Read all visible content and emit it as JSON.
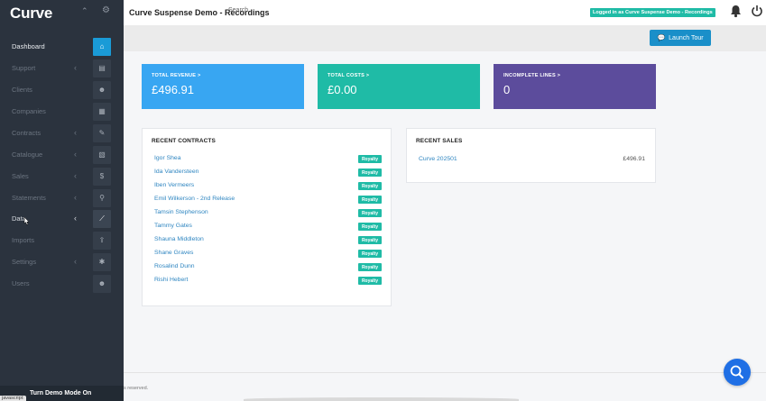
{
  "brand": {
    "logo_text": "Curve"
  },
  "sidebar": {
    "items": [
      {
        "label": "Dashboard",
        "icon": "home-icon",
        "glyph": "⌂"
      },
      {
        "label": "Support",
        "icon": "table-icon",
        "glyph": "▤",
        "chevron": "‹"
      },
      {
        "label": "Clients",
        "icon": "users-icon",
        "glyph": "☻"
      },
      {
        "label": "Companies",
        "icon": "building-icon",
        "glyph": "▦"
      },
      {
        "label": "Contracts",
        "icon": "pencil-icon",
        "glyph": "✎",
        "chevron": "‹"
      },
      {
        "label": "Catalogue",
        "icon": "book-icon",
        "glyph": "▧",
        "chevron": "‹"
      },
      {
        "label": "Sales",
        "icon": "dollar-icon",
        "glyph": "$",
        "chevron": "‹"
      },
      {
        "label": "Statements",
        "icon": "paperclip-icon",
        "glyph": "⚲",
        "chevron": "‹"
      },
      {
        "label": "Data",
        "icon": "chart-icon",
        "glyph": "⟋",
        "chevron": "‹"
      },
      {
        "label": "Imports",
        "icon": "upload-icon",
        "glyph": "⇪"
      },
      {
        "label": "Settings",
        "icon": "gear-icon",
        "glyph": "✱",
        "chevron": "‹"
      },
      {
        "label": "Users",
        "icon": "users-icon",
        "glyph": "☻"
      }
    ],
    "demo_mode_label": "Turn Demo Mode On",
    "status_text": "javascript:"
  },
  "header": {
    "title": "Curve Suspense Demo - Recordings",
    "search_ghost": "Search",
    "login_badge": "Logged in as Curve Suspense Demo - Recordings"
  },
  "toolbar": {
    "launch_tour_label": "Launch Tour"
  },
  "stats": [
    {
      "label": "TOTAL REVENUE >",
      "value": "£496.91",
      "color": "#38a6f2"
    },
    {
      "label": "TOTAL COSTS >",
      "value": "£0.00",
      "color": "#1fbba6"
    },
    {
      "label": "INCOMPLETE LINES >",
      "value": "0",
      "color": "#5c4c9c"
    }
  ],
  "recent_contracts": {
    "title": "RECENT CONTRACTS",
    "rows": [
      {
        "name": "Igor Shea",
        "badge": "Royalty"
      },
      {
        "name": "Ida Vandersteen",
        "badge": "Royalty"
      },
      {
        "name": "Iben Vermeers",
        "badge": "Royalty"
      },
      {
        "name": "Emil Wilkerson - 2nd Release",
        "badge": "Royalty"
      },
      {
        "name": "Tamsin Stephenson",
        "badge": "Royalty"
      },
      {
        "name": "Tammy Gates",
        "badge": "Royalty"
      },
      {
        "name": "Shauna Middleton",
        "badge": "Royalty"
      },
      {
        "name": "Shane Graves",
        "badge": "Royalty"
      },
      {
        "name": "Rosalind Dunn",
        "badge": "Royalty"
      },
      {
        "name": "Rishi Hebert",
        "badge": "Royalty"
      }
    ]
  },
  "recent_sales": {
    "title": "RECENT SALES",
    "rows": [
      {
        "name": "Curve 202501",
        "amount": "£496.91"
      }
    ]
  },
  "footer": {
    "text": "s reserved."
  }
}
